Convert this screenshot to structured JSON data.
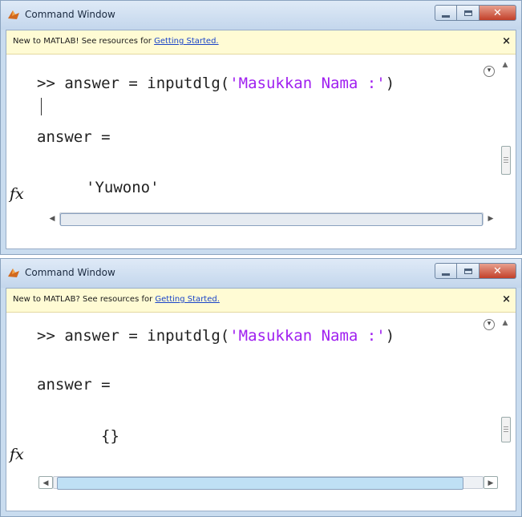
{
  "window1": {
    "title": "Command Window",
    "info_prefix": "New to MATLAB! See resources for ",
    "info_link": "Getting Started.",
    "info_close": "×",
    "cmd_prompt": ">> answer = inputdlg(",
    "cmd_arg": "'Masukkan Nama :'",
    "cmd_close": ")",
    "result_label": "answer =",
    "result_value": "'Yuwono'",
    "fx": "fx"
  },
  "window2": {
    "title": "Command Window",
    "info_prefix": "New to MATLAB? See resources for ",
    "info_link": "Getting Started.",
    "info_close": "×",
    "cmd_prompt": ">> answer = inputdlg(",
    "cmd_arg": "'Masukkan Nama :'",
    "cmd_close": ")",
    "result_label": "answer =",
    "result_value": "{}",
    "fx": "fx"
  },
  "colors": {
    "string": "#a020f0",
    "link": "#1a44c8",
    "info_bg": "#fffbd4",
    "close_button": "#c2402a",
    "window_frame": "#c9dcef"
  },
  "icons": [
    "matlab-logo-icon",
    "minimize-icon",
    "maximize-icon",
    "close-icon",
    "scroll-arrow-icon"
  ]
}
